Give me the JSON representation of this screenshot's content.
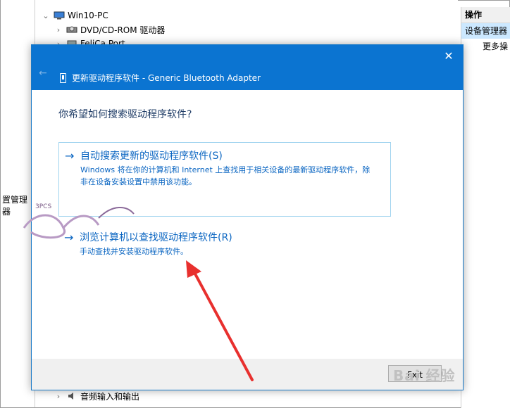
{
  "tree": {
    "root_label": "Win10-PC",
    "items": [
      {
        "label": "DVD/CD-ROM 驱动器"
      },
      {
        "label": "FeliCa Port"
      }
    ],
    "bottom_item": "音频输入和输出"
  },
  "left_panel": {
    "label": "置管理器"
  },
  "actions_panel": {
    "header": "操作",
    "selected": "设备管理器",
    "more": "更多操"
  },
  "dialog": {
    "title": "更新驱动程序软件 - Generic Bluetooth Adapter",
    "close_glyph": "✕",
    "back_glyph": "←",
    "question": "你希望如何搜索驱动程序软件?",
    "option_auto": {
      "title": "自动搜索更新的驱动程序软件(S)",
      "description": "Windows 将在你的计算机和 Internet 上查找用于相关设备的最新驱动程序软件，除非在设备安装设置中禁用该功能。"
    },
    "option_browse": {
      "title": "浏览计算机以查找驱动程序软件(R)",
      "description": "手动查找并安装驱动程序软件。"
    },
    "next_label": "Fxit"
  },
  "overlay": {
    "watermark_text": "3PCS",
    "baidu_text": "Bai 经验",
    "arrow_color": "#e8302e"
  },
  "colors": {
    "titlebar": "#0b74d1",
    "link": "#0b66c2",
    "selection": "#cce8ff"
  }
}
